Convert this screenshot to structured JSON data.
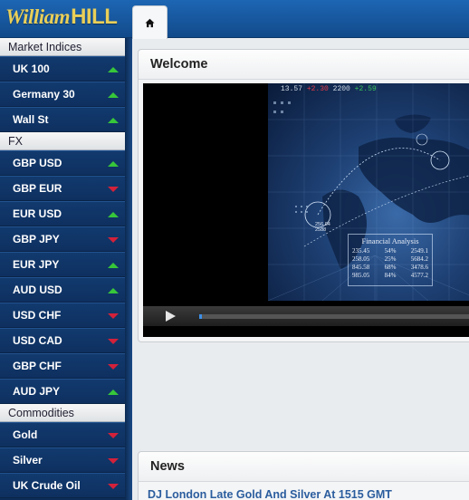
{
  "brand": {
    "part1": "William",
    "part2": "HILL",
    "color": "#e9cf59"
  },
  "tabs": [
    {
      "icon": "home-icon",
      "active": true
    }
  ],
  "sidebar": {
    "sections": [
      {
        "title": "Market Indices",
        "items": [
          {
            "label": "UK 100",
            "trend": "up"
          },
          {
            "label": "Germany 30",
            "trend": "up"
          },
          {
            "label": "Wall St",
            "trend": "up"
          }
        ]
      },
      {
        "title": "FX",
        "items": [
          {
            "label": "GBP USD",
            "trend": "up"
          },
          {
            "label": "GBP EUR",
            "trend": "down"
          },
          {
            "label": "EUR USD",
            "trend": "up"
          },
          {
            "label": "GBP JPY",
            "trend": "down"
          },
          {
            "label": "EUR JPY",
            "trend": "up"
          },
          {
            "label": "AUD USD",
            "trend": "up"
          },
          {
            "label": "USD CHF",
            "trend": "down"
          },
          {
            "label": "USD CAD",
            "trend": "down"
          },
          {
            "label": "GBP CHF",
            "trend": "down"
          },
          {
            "label": "AUD JPY",
            "trend": "up"
          }
        ]
      },
      {
        "title": "Commodities",
        "items": [
          {
            "label": "Gold",
            "trend": "down"
          },
          {
            "label": "Silver",
            "trend": "down"
          },
          {
            "label": "UK Crude Oil",
            "trend": "down"
          }
        ]
      }
    ]
  },
  "welcome": {
    "title": "Welcome",
    "video": {
      "ticker": [
        "13.57",
        "+2.30",
        "2200",
        "+2.59"
      ],
      "chart_label_1": "256.04",
      "chart_label_2": "2588",
      "financial_analysis": {
        "title": "Financial Analysis",
        "rows": [
          [
            "235.45",
            "54%",
            "2549.1"
          ],
          [
            "258.05",
            "25%",
            "5684.2"
          ],
          [
            "845.58",
            "68%",
            "3478.6"
          ],
          [
            "985.05",
            "84%",
            "4577.2"
          ]
        ]
      },
      "progress_fraction": 0.01
    }
  },
  "news": {
    "title": "News",
    "headline": "DJ London Late Gold And Silver At 1515 GMT"
  },
  "colors": {
    "up": "#37c63a",
    "down": "#d3213a",
    "link": "#2b5d9e"
  }
}
